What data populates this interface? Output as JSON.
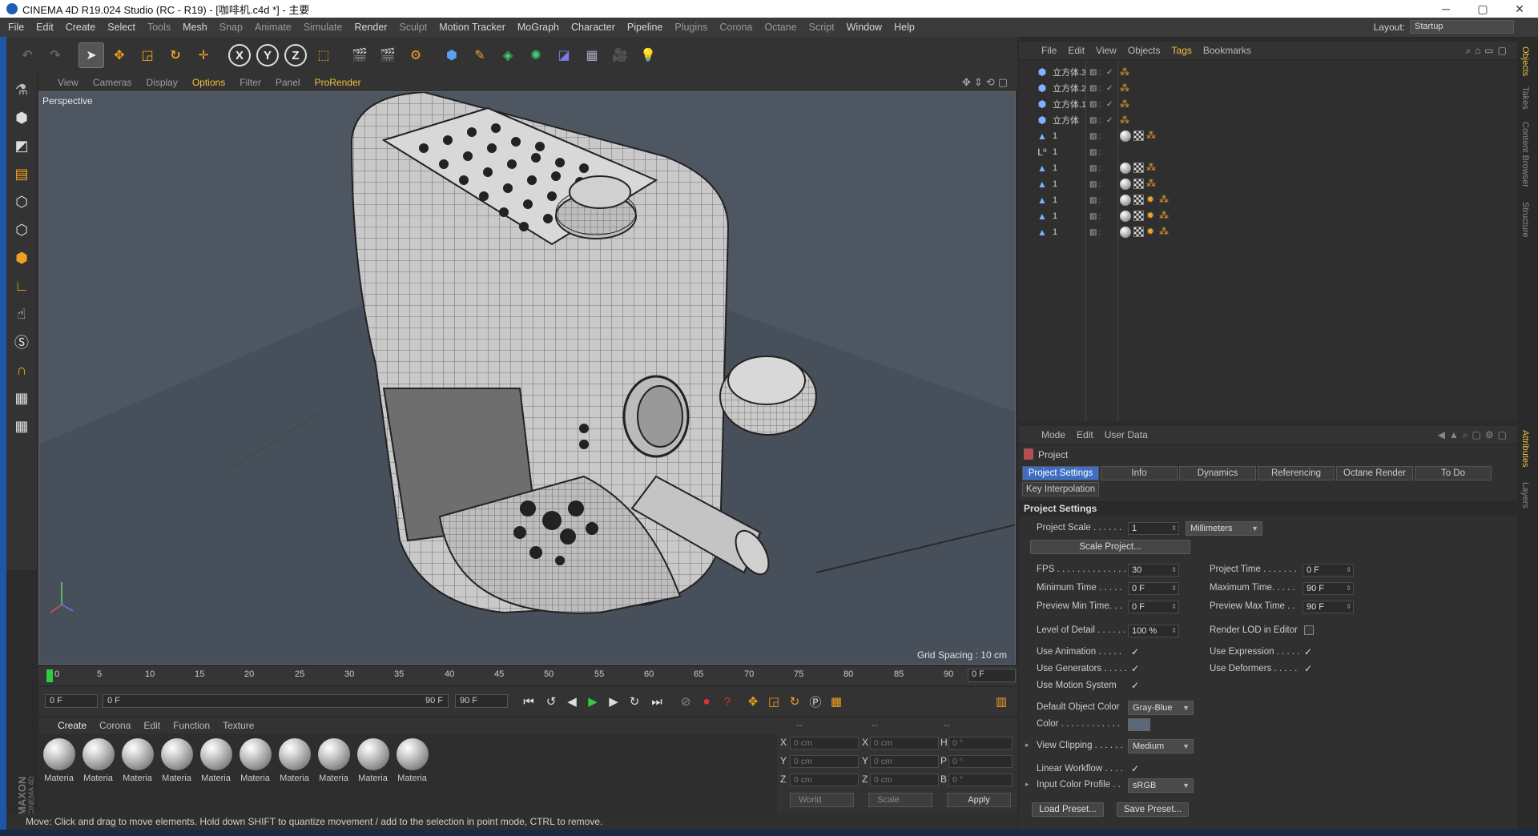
{
  "title": "CINEMA 4D R19.024 Studio (RC - R19) - [咖啡机.c4d *] - 主要",
  "window_controls": [
    "─",
    "▢",
    "✕"
  ],
  "menubar": {
    "items": [
      "File",
      "Edit",
      "Create",
      "Select",
      "Tools",
      "Mesh",
      "Snap",
      "Animate",
      "Simulate",
      "Render",
      "Sculpt",
      "Motion Tracker",
      "MoGraph",
      "Character",
      "Pipeline",
      "Plugins",
      "Corona",
      "Octane",
      "Script",
      "Window",
      "Help"
    ],
    "layout_label": "Layout:",
    "layout_value": "Startup"
  },
  "toolbar": {
    "axis_x": "X",
    "axis_y": "Y",
    "axis_z": "Z"
  },
  "viewport": {
    "menu": [
      "View",
      "Cameras",
      "Display",
      "Options",
      "Filter",
      "Panel",
      "ProRender"
    ],
    "label": "Perspective",
    "grid_spacing": "Grid Spacing : 10 cm"
  },
  "timeline": {
    "ticks": [
      "0",
      "5",
      "10",
      "15",
      "20",
      "25",
      "30",
      "35",
      "40",
      "45",
      "50",
      "55",
      "60",
      "65",
      "70",
      "75",
      "80",
      "85",
      "90"
    ],
    "current_frame": "0 F",
    "start_field": "0 F",
    "range_start": "0 F",
    "range_end": "90 F",
    "end_field": "90 F"
  },
  "material_manager": {
    "menu": [
      "Create",
      "Corona",
      "Edit",
      "Function",
      "Texture"
    ],
    "materials": [
      "Materia",
      "Materia",
      "Materia",
      "Materia",
      "Materia",
      "Materia",
      "Materia",
      "Materia",
      "Materia",
      "Materia"
    ]
  },
  "coordinates": {
    "headers": [
      "--",
      "--",
      "--"
    ],
    "rows": [
      {
        "l1": "X",
        "v1": "0 cm",
        "l2": "X",
        "v2": "0 cm",
        "l3": "H",
        "v3": "0 °"
      },
      {
        "l1": "Y",
        "v1": "0 cm",
        "l2": "Y",
        "v2": "0 cm",
        "l3": "P",
        "v3": "0 °"
      },
      {
        "l1": "Z",
        "v1": "0 cm",
        "l2": "Z",
        "v2": "0 cm",
        "l3": "B",
        "v3": "0 °"
      }
    ],
    "world_dropdown": "World",
    "scale_dropdown": "Scale",
    "apply_label": "Apply"
  },
  "status_bar": "Move: Click and drag to move elements. Hold down SHIFT to quantize movement / add to the selection in point mode, CTRL to remove.",
  "object_manager": {
    "menu": [
      "File",
      "Edit",
      "View",
      "Objects",
      "Tags",
      "Bookmarks"
    ],
    "objects": [
      {
        "name": "立方体.3",
        "icon": "cube-icon",
        "glyph": "⬢"
      },
      {
        "name": "立方体.2",
        "icon": "cube-icon",
        "glyph": "⬢"
      },
      {
        "name": "立方体.1",
        "icon": "cube-icon",
        "glyph": "⬢"
      },
      {
        "name": "立方体",
        "icon": "cube-icon",
        "glyph": "⬢"
      },
      {
        "name": "1",
        "icon": "polygon-object-icon",
        "glyph": "▲"
      },
      {
        "name": "1",
        "icon": "null-object-icon",
        "glyph": "L⁰"
      },
      {
        "name": "1",
        "icon": "polygon-object-icon",
        "glyph": "▲"
      },
      {
        "name": "1",
        "icon": "polygon-object-icon",
        "glyph": "▲"
      },
      {
        "name": "1",
        "icon": "polygon-object-icon",
        "glyph": "▲"
      },
      {
        "name": "1",
        "icon": "polygon-object-icon",
        "glyph": "▲"
      },
      {
        "name": "1",
        "icon": "polygon-object-icon",
        "glyph": "▲"
      }
    ]
  },
  "right_vertical_tabs": [
    "Objects",
    "Takes",
    "Content Browser",
    "Structure",
    "Attributes",
    "Layers"
  ],
  "attribute_manager": {
    "menu": [
      "Mode",
      "Edit",
      "User Data"
    ],
    "header": "Project",
    "tabs": [
      "Project Settings",
      "Info",
      "Dynamics",
      "Referencing",
      "Octane Render",
      "To Do"
    ],
    "tab_row2": "Key Interpolation",
    "section_title": "Project Settings",
    "project_scale_label": "Project Scale . . . . . .",
    "project_scale_value": "1",
    "project_scale_unit": "Millimeters",
    "scale_project_btn": "Scale Project...",
    "fps_label": "FPS . . . . . . . . . . . . . . .",
    "fps_value": "30",
    "project_time_label": "Project Time . . . . . . .",
    "project_time_value": "0 F",
    "min_time_label": "Minimum Time . . . . .",
    "min_time_value": "0 F",
    "max_time_label": "Maximum Time. . . . .",
    "max_time_value": "90 F",
    "prev_min_label": "Preview Min Time. . .",
    "prev_min_value": "0 F",
    "prev_max_label": "Preview Max Time . .",
    "prev_max_value": "90 F",
    "lod_label": "Level of Detail . . . . . .",
    "lod_value": "100 %",
    "render_lod_label": "Render LOD in Editor",
    "use_animation_label": "Use Animation . . . . .",
    "use_expression_label": "Use Expression . . . . .",
    "use_generators_label": "Use Generators . . . . .",
    "use_deformers_label": "Use Deformers . . . . .",
    "use_motion_label": "Use Motion System",
    "default_color_label": "Default Object Color",
    "default_color_value": "Gray-Blue",
    "color_label": "Color . . . . . . . . . . . .",
    "view_clipping_label": "View Clipping . . . . . .",
    "view_clipping_value": "Medium",
    "linear_workflow_label": "Linear Workflow . . . .",
    "input_color_label": "Input Color Profile . .",
    "input_color_value": "sRGB",
    "load_preset": "Load Preset...",
    "save_preset": "Save Preset..."
  }
}
